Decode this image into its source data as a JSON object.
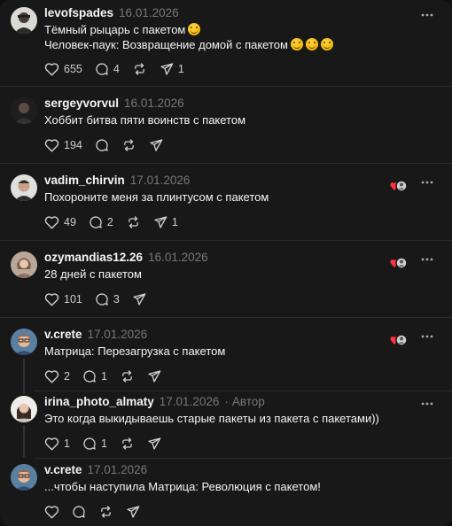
{
  "posts": [
    {
      "username": "levofspades",
      "date": "16.01.2026",
      "lines": [
        "Тёмный рыцарь с пакетом",
        "Человек-паук: Возвращение домой с пакетом"
      ],
      "likes": "655",
      "comments": "4",
      "reposts": "",
      "shares": "1",
      "liked_by_author": false,
      "author_tag": ""
    },
    {
      "username": "sergeyvorvul",
      "date": "16.01.2026",
      "lines": [
        "Хоббит битва пяти воинств с пакетом"
      ],
      "likes": "194",
      "comments": "",
      "reposts": "",
      "shares": "",
      "liked_by_author": false,
      "author_tag": ""
    },
    {
      "username": "vadim_chirvin",
      "date": "17.01.2026",
      "lines": [
        "Похороните меня за плинтусом с пакетом"
      ],
      "likes": "49",
      "comments": "2",
      "reposts": "",
      "shares": "1",
      "liked_by_author": true,
      "author_tag": ""
    },
    {
      "username": "ozymandias12.26",
      "date": "16.01.2026",
      "lines": [
        "28 дней с пакетом"
      ],
      "likes": "101",
      "comments": "3",
      "reposts": "",
      "shares": "",
      "liked_by_author": true,
      "author_tag": ""
    },
    {
      "username": "v.crete",
      "date": "17.01.2026",
      "lines": [
        "Матрица: Перезагрузка с пакетом"
      ],
      "likes": "2",
      "comments": "1",
      "reposts": "",
      "shares": "",
      "liked_by_author": true,
      "author_tag": ""
    },
    {
      "username": "irina_photo_almaty",
      "date": "17.01.2026",
      "lines": [
        "Это когда выкидываешь старые пакеты из пакета с пакетами))"
      ],
      "likes": "1",
      "comments": "1",
      "reposts": "",
      "shares": "",
      "liked_by_author": false,
      "author_tag": "Автор"
    },
    {
      "username": "v.crete",
      "date": "17.01.2026",
      "lines": [
        "...чтобы наступила Матрица: Революция с пакетом!"
      ],
      "likes": "",
      "comments": "",
      "reposts": "",
      "shares": "",
      "liked_by_author": false,
      "author_tag": ""
    }
  ],
  "icons": {
    "like": "heart-icon",
    "comment": "comment-icon",
    "repost": "repost-icon",
    "share": "share-icon",
    "more": "more-icon",
    "emoji": "laughing-emoji-icon"
  },
  "colors": {
    "background": "#101010",
    "card": "#181818",
    "text": "#f3f5f7",
    "muted": "#777777",
    "divider": "#2d2d2d",
    "heart_red": "#ff3040"
  }
}
